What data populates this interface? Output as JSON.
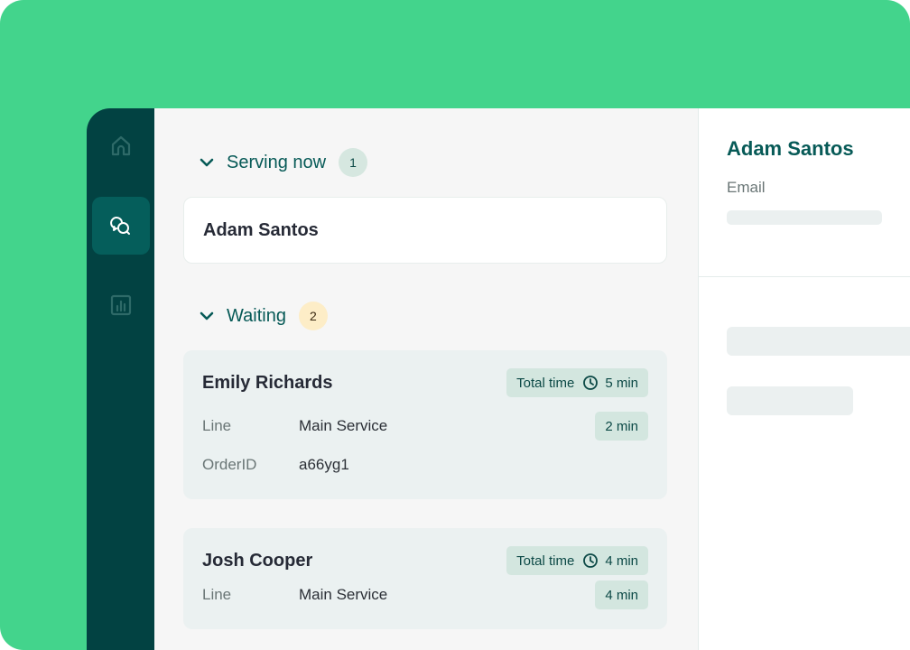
{
  "sidebar": {
    "items": [
      {
        "name": "home",
        "icon": "home-icon",
        "active": false
      },
      {
        "name": "conversations",
        "icon": "chat-bubbles-icon",
        "active": true
      },
      {
        "name": "analytics",
        "icon": "bar-chart-icon",
        "active": false
      }
    ]
  },
  "queue": {
    "serving": {
      "title": "Serving now",
      "count": "1",
      "items": [
        {
          "name": "Adam Santos"
        }
      ]
    },
    "waiting": {
      "title": "Waiting",
      "count": "2",
      "items": [
        {
          "name": "Emily Richards",
          "total_time_label": "Total time",
          "total_time": "5 min",
          "line_label": "Line",
          "line_value": "Main Service",
          "line_time": "2 min",
          "order_label": "OrderID",
          "order_value": "a66yg1"
        },
        {
          "name": "Josh Cooper",
          "total_time_label": "Total time",
          "total_time": "4 min",
          "line_label": "Line",
          "line_value": "Main Service",
          "line_time": "4 min"
        }
      ]
    }
  },
  "detail": {
    "title": "Adam Santos",
    "email_label": "Email"
  },
  "colors": {
    "background_green": "#43d48c",
    "sidebar": "#024242",
    "sidebar_active": "#055e5b",
    "accent_text": "#075a57",
    "serving_badge": "#d6e7e0",
    "waiting_badge": "#fdedc7",
    "pill": "#d3e6df",
    "card": "#ebf1f1"
  }
}
